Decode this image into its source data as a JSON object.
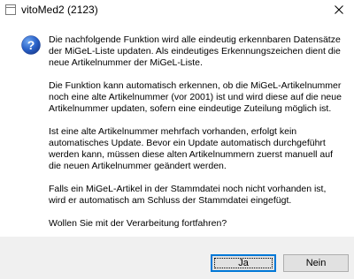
{
  "window": {
    "title": "vitoMed2 (2123)",
    "close_symbol": "✕"
  },
  "icons": {
    "app": "app-icon",
    "message": "question-icon",
    "close": "close-icon"
  },
  "message": {
    "paragraphs": [
      "Die nachfolgende Funktion wird alle eindeutig erkennbaren Datensätze\nder MiGeL-Liste updaten. Als eindeutiges Erkennungszeichen dient die\nneue Artikelnummer der MiGeL-Liste.",
      "Die Funktion kann automatisch erkennen, ob die MiGeL-Artikelnummer\nnoch eine alte Artikelnummer (vor 2001) ist und wird diese auf die neue\nArtikelnummer updaten, sofern eine eindeutige Zuteilung möglich ist.",
      "Ist eine alte Artikelnummer mehrfach vorhanden, erfolgt kein\nautomatisches Update. Bevor ein Update automatisch durchgeführt\nwerden kann, müssen diese alten Artikelnummern zuerst manuell auf\ndie neuen Artikelnummer geändert werden.",
      "Falls ein MiGeL-Artikel in der Stammdatei noch nicht vorhanden ist,\nwird er automatisch am Schluss der Stammdatei eingefügt.",
      "Wollen Sie mit der Verarbeitung fortfahren?"
    ]
  },
  "buttons": {
    "yes_label": "Ja",
    "no_label": "Nein"
  },
  "colors": {
    "accent": "#0078d7",
    "footer_bg": "#f0f0f0",
    "button_bg": "#e1e1e1"
  }
}
